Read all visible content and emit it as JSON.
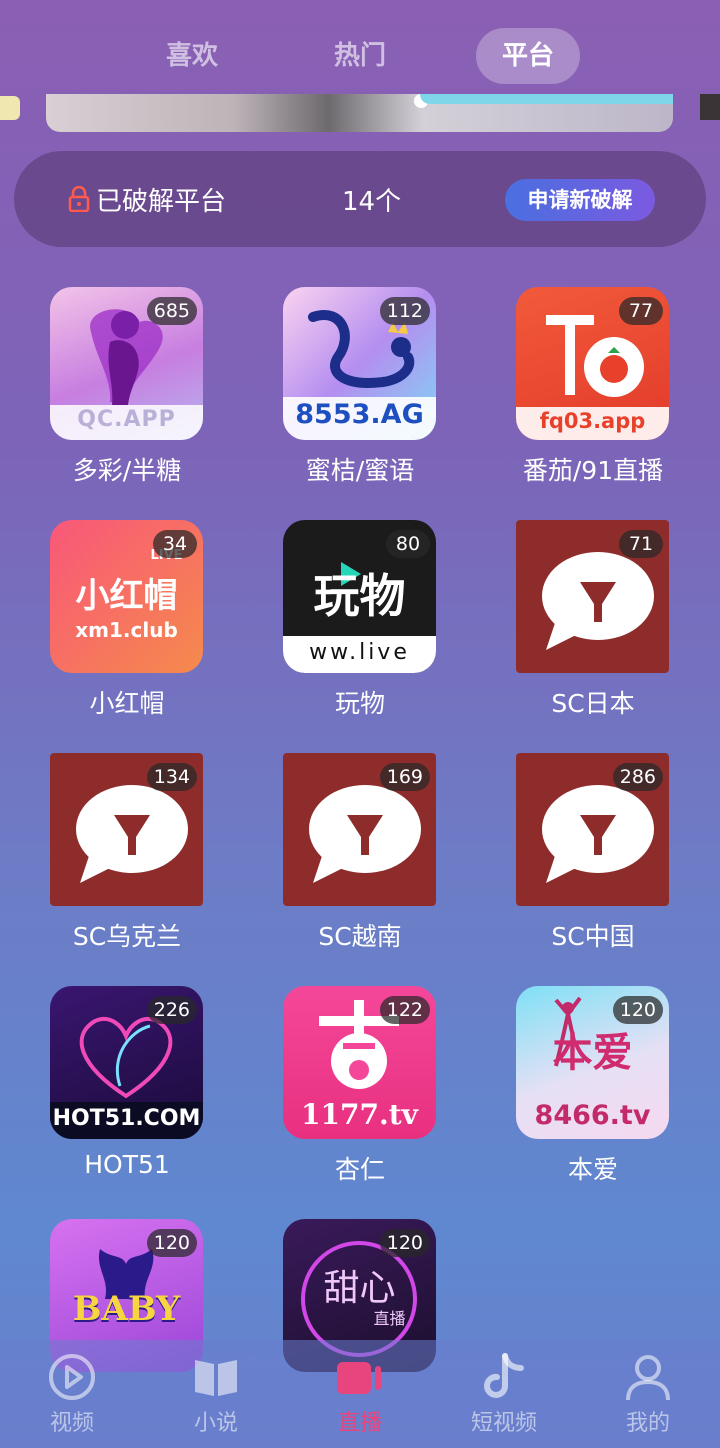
{
  "top_tabs": [
    {
      "label": "喜欢",
      "active": false
    },
    {
      "label": "热门",
      "active": false
    },
    {
      "label": "平台",
      "active": true
    }
  ],
  "info_bar": {
    "label": "已破解平台",
    "count": "14个",
    "apply_button": "申请新破解"
  },
  "apps": [
    {
      "name": "多彩/半糖",
      "badge": "685",
      "icon_text": "QC.APP"
    },
    {
      "name": "蜜桔/蜜语",
      "badge": "112",
      "icon_text": "8553.AG"
    },
    {
      "name": "番茄/91直播",
      "badge": "77",
      "icon_text": "fq03.app"
    },
    {
      "name": "小红帽",
      "badge": "34",
      "icon_text": "小红帽",
      "icon_sub": "xm1.club",
      "icon_tag": "LIVE"
    },
    {
      "name": "玩物",
      "badge": "80",
      "icon_text": "玩物",
      "icon_sub": "ww.live"
    },
    {
      "name": "SC日本",
      "badge": "71"
    },
    {
      "name": "SC乌克兰",
      "badge": "134"
    },
    {
      "name": "SC越南",
      "badge": "169"
    },
    {
      "name": "SC中国",
      "badge": "286"
    },
    {
      "name": "HOT51",
      "badge": "226",
      "icon_text": "HOT51.COM"
    },
    {
      "name": "杏仁",
      "badge": "122",
      "icon_text": "1177.tv"
    },
    {
      "name": "本爱",
      "badge": "120",
      "icon_text": "本爱",
      "icon_sub": "8466.tv"
    },
    {
      "name": "",
      "badge": "120",
      "icon_text": "BABY"
    },
    {
      "name": "",
      "badge": "120",
      "icon_text": "甜心",
      "icon_sub": "直播"
    }
  ],
  "bottom_nav": [
    {
      "label": "视频",
      "icon": "play-circle-icon",
      "active": false
    },
    {
      "label": "小说",
      "icon": "book-icon",
      "active": false
    },
    {
      "label": "直播",
      "icon": "live-camera-icon",
      "active": true
    },
    {
      "label": "短视频",
      "icon": "music-note-icon",
      "active": false
    },
    {
      "label": "我的",
      "icon": "user-icon",
      "active": false
    }
  ],
  "colors": {
    "active_nav": "#e8457f",
    "sc_icon_bg": "#8e2c2c",
    "apply_button_start": "#4a6fe0",
    "apply_button_end": "#7b5ae0"
  }
}
